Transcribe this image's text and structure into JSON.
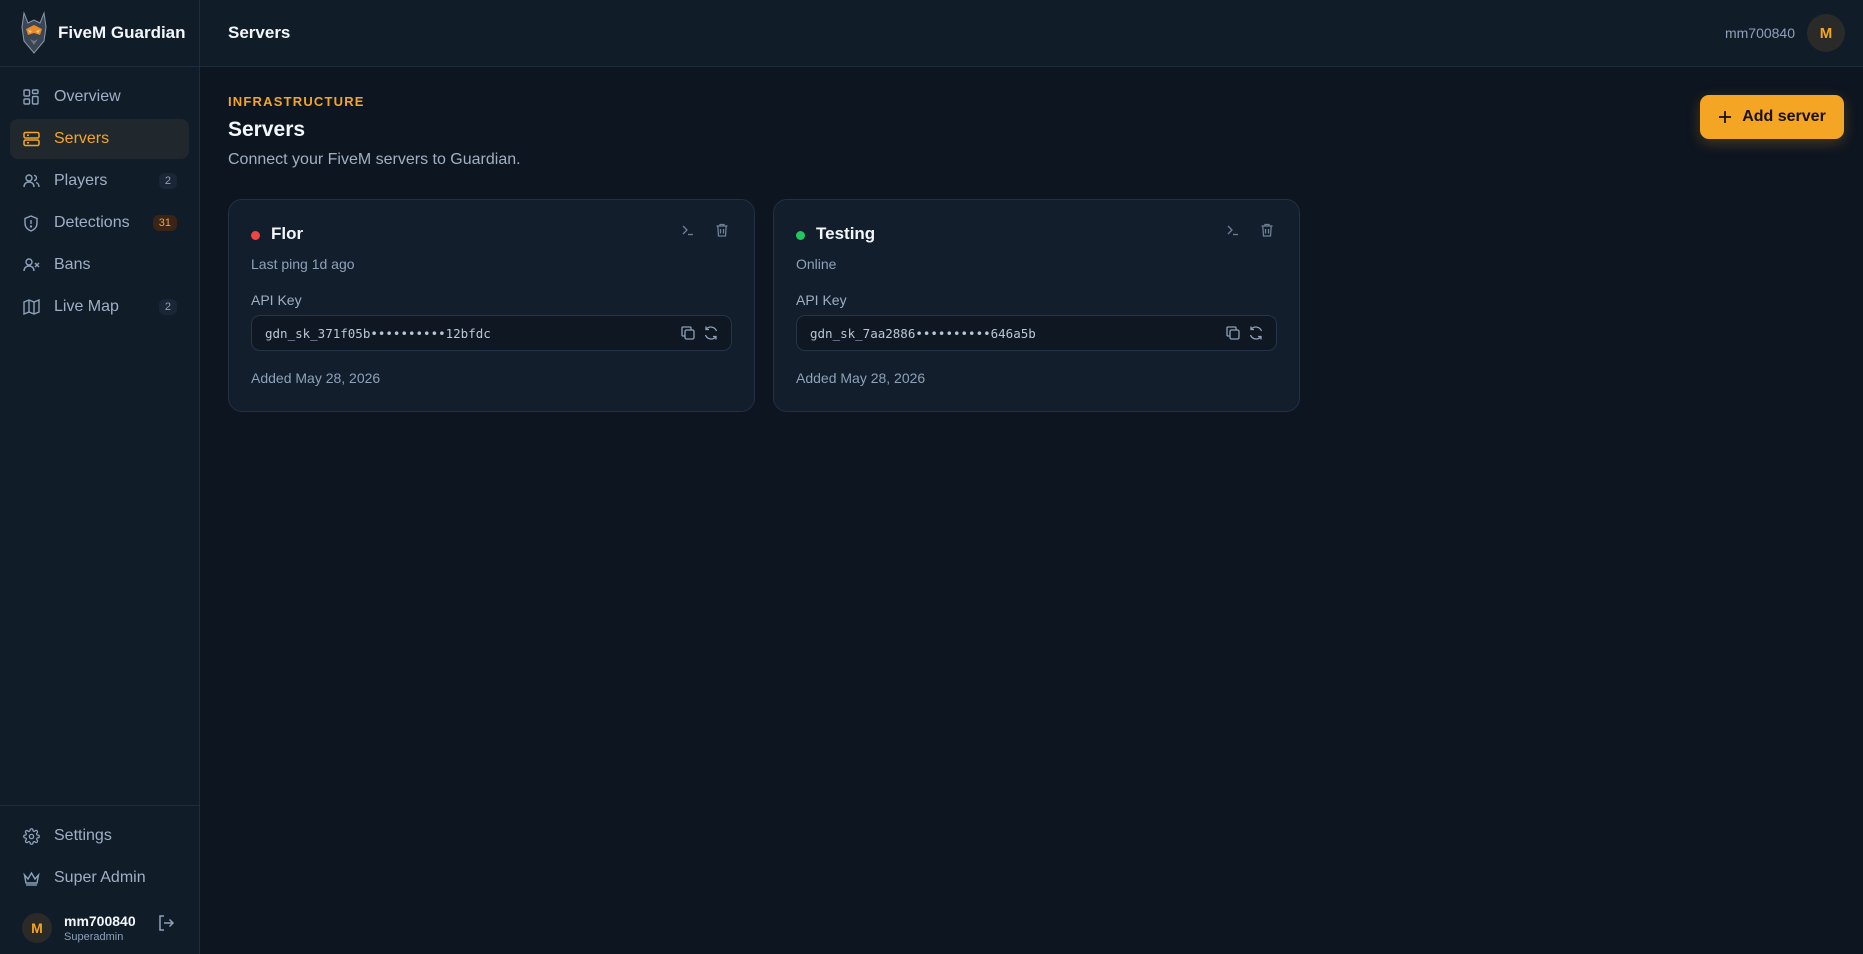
{
  "brand": {
    "name": "FiveM Guardian"
  },
  "sidebar": {
    "items": [
      {
        "label": "Overview",
        "icon": "grid-icon",
        "badge": ""
      },
      {
        "label": "Servers",
        "icon": "server-icon",
        "badge": "",
        "active": true
      },
      {
        "label": "Players",
        "icon": "users-icon",
        "badge": "2"
      },
      {
        "label": "Detections",
        "icon": "shield-icon",
        "badge": "31"
      },
      {
        "label": "Bans",
        "icon": "user-x-icon",
        "badge": ""
      },
      {
        "label": "Live Map",
        "icon": "map-icon",
        "badge": "2"
      }
    ],
    "bottom_items": [
      {
        "label": "Settings",
        "icon": "gear-icon"
      },
      {
        "label": "Super Admin",
        "icon": "crown-icon"
      }
    ],
    "user": {
      "initial": "M",
      "name": "mm700840",
      "role": "Superadmin"
    }
  },
  "topbar": {
    "title": "Servers",
    "username": "mm700840",
    "avatar_initial": "M"
  },
  "main": {
    "eyebrow": "INFRASTRUCTURE",
    "title": "Servers",
    "subtitle": "Connect your FiveM servers to Guardian.",
    "add_button": "Add server"
  },
  "servers": [
    {
      "name": "Flor",
      "status_color": "#ef4444",
      "status_text": "Last ping 1d ago",
      "api_label": "API Key",
      "api_key": "gdn_sk_371f05b••••••••••12bfdc",
      "added": "Added May 28, 2026"
    },
    {
      "name": "Testing",
      "status_color": "#22c55e",
      "status_text": "Online",
      "api_label": "API Key",
      "api_key": "gdn_sk_7aa2886••••••••••646a5b",
      "added": "Added May 28, 2026"
    }
  ],
  "colors": {
    "accent": "#f5a524",
    "background": "#0d1520",
    "panel": "#111c29"
  }
}
